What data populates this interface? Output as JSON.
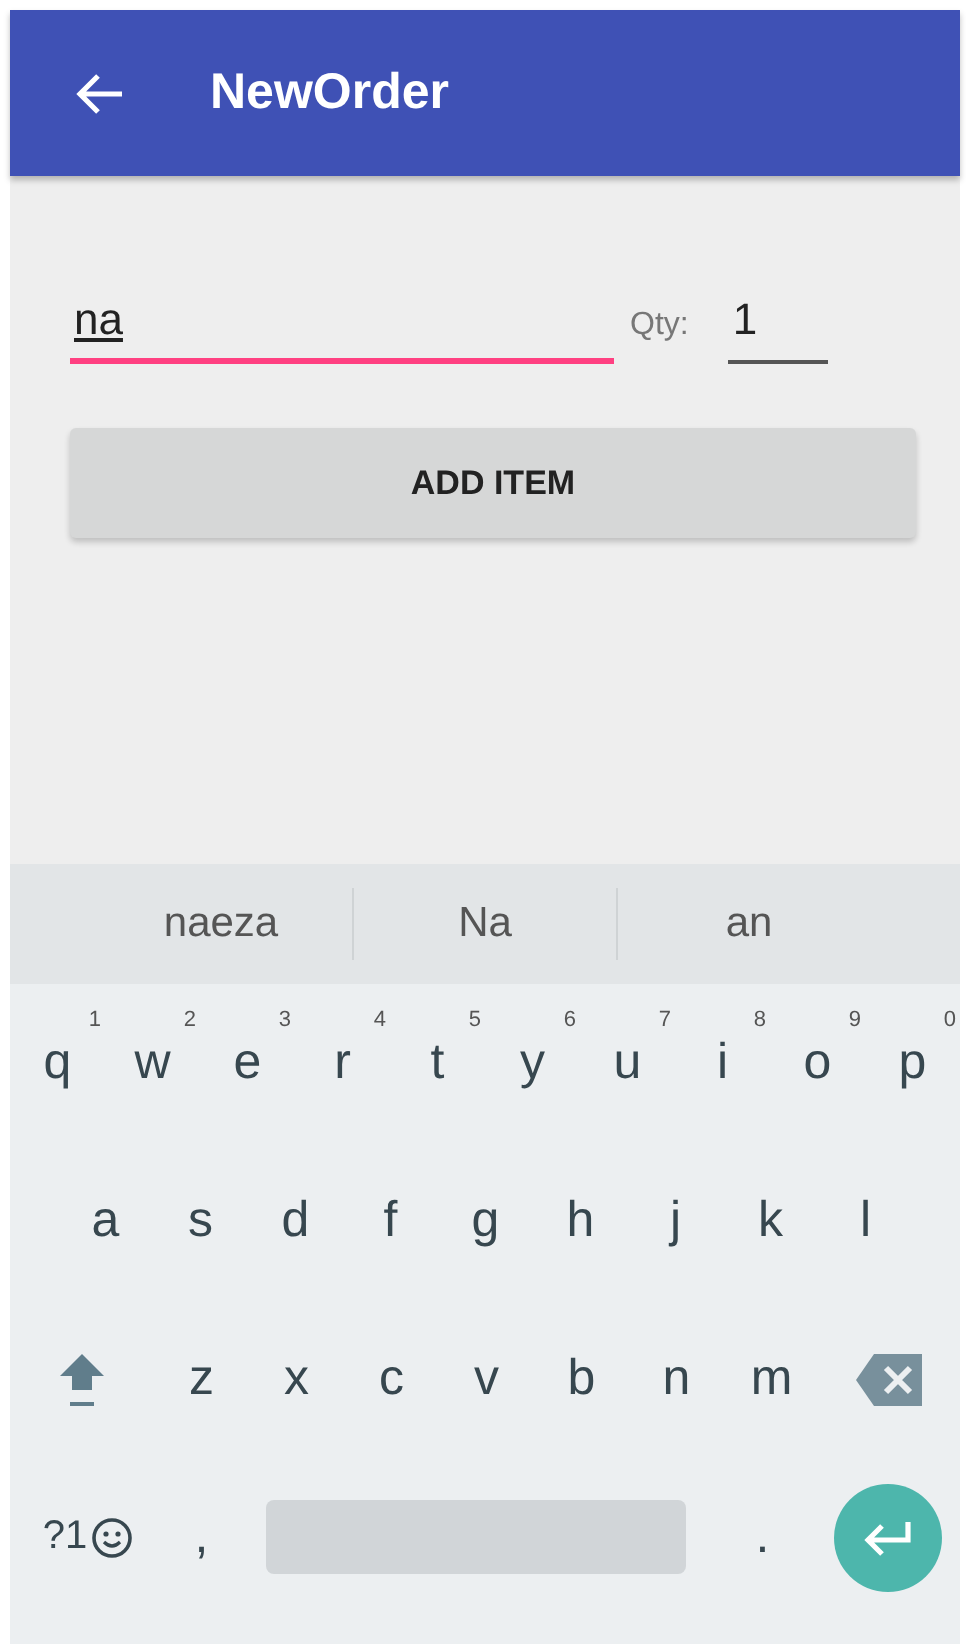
{
  "app_bar": {
    "title": "NewOrder"
  },
  "form": {
    "item_field": {
      "value": "na",
      "focused": true
    },
    "qty_label": "Qty:",
    "qty_field": {
      "value": "1",
      "focused": false
    },
    "add_button": "ADD ITEM"
  },
  "keyboard": {
    "suggestions": [
      "naeza",
      "Na",
      "an"
    ],
    "rows": [
      [
        {
          "key": "q",
          "hint": "1"
        },
        {
          "key": "w",
          "hint": "2"
        },
        {
          "key": "e",
          "hint": "3"
        },
        {
          "key": "r",
          "hint": "4"
        },
        {
          "key": "t",
          "hint": "5"
        },
        {
          "key": "y",
          "hint": "6"
        },
        {
          "key": "u",
          "hint": "7"
        },
        {
          "key": "i",
          "hint": "8"
        },
        {
          "key": "o",
          "hint": "9"
        },
        {
          "key": "p",
          "hint": "0"
        }
      ],
      [
        {
          "key": "a"
        },
        {
          "key": "s"
        },
        {
          "key": "d"
        },
        {
          "key": "f"
        },
        {
          "key": "g"
        },
        {
          "key": "h"
        },
        {
          "key": "j"
        },
        {
          "key": "k"
        },
        {
          "key": "l"
        }
      ],
      [
        {
          "key": "z"
        },
        {
          "key": "x"
        },
        {
          "key": "c"
        },
        {
          "key": "v"
        },
        {
          "key": "b"
        },
        {
          "key": "n"
        },
        {
          "key": "m"
        }
      ]
    ],
    "symbols_key": "?1",
    "comma_key": ",",
    "period_key": "."
  }
}
